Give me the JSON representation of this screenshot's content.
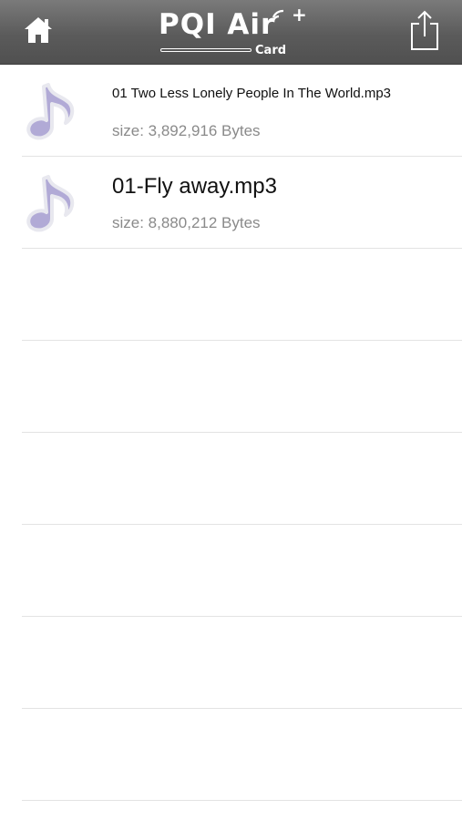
{
  "header": {
    "logo_main": "PQI Air",
    "logo_plus": "+",
    "logo_sub": "Card",
    "home_icon": "home-icon",
    "share_icon": "share-icon",
    "background_color": "#5b5b5b"
  },
  "files": [
    {
      "name": "01 Two Less Lonely People In The World.mp3",
      "size": "size: 3,892,916 Bytes",
      "icon": "music-note-icon"
    },
    {
      "name": "01-Fly away.mp3",
      "size": "size: 8,880,212 Bytes",
      "icon": "music-note-icon"
    }
  ],
  "colors": {
    "icon_fill": "#b1aad6",
    "icon_outline": "#e7e7ee",
    "divider": "#e3e3e3"
  }
}
